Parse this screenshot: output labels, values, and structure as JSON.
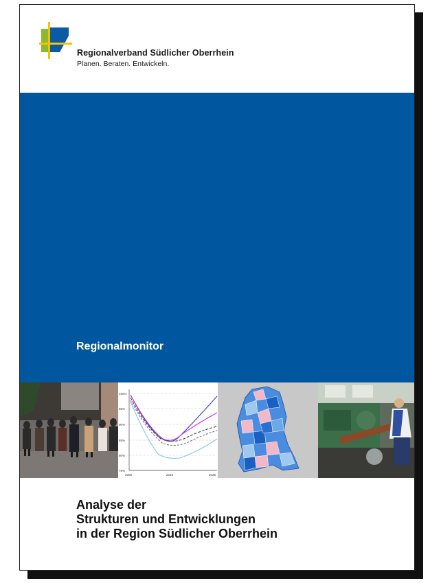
{
  "organization": {
    "name": "Regionalverband Südlicher Oberrhein",
    "slogan": "Planen. Beraten. Entwickeln.",
    "logo_colors": {
      "green": "#8cb92e",
      "yellow": "#f5c400",
      "blue": "#0a5aa5"
    }
  },
  "band": {
    "title": "Regionalmonitor",
    "color": "#0156a0"
  },
  "image_strip": {
    "panels": [
      {
        "icon": "crowd-photo"
      },
      {
        "icon": "line-chart-thumbnail",
        "y_ticks": [
          "100%",
          "95%",
          "90%",
          "85%",
          "80%",
          "75%"
        ],
        "x_ticks": [
          "2005",
          "2015",
          "2025"
        ]
      },
      {
        "icon": "regional-map-thumbnail"
      },
      {
        "icon": "machine-worker-photo"
      }
    ]
  },
  "subtitle": {
    "line1": "Analyse der",
    "line2": "Strukturen und Entwicklungen",
    "line3": "in der Region Südlicher Oberrhein"
  }
}
